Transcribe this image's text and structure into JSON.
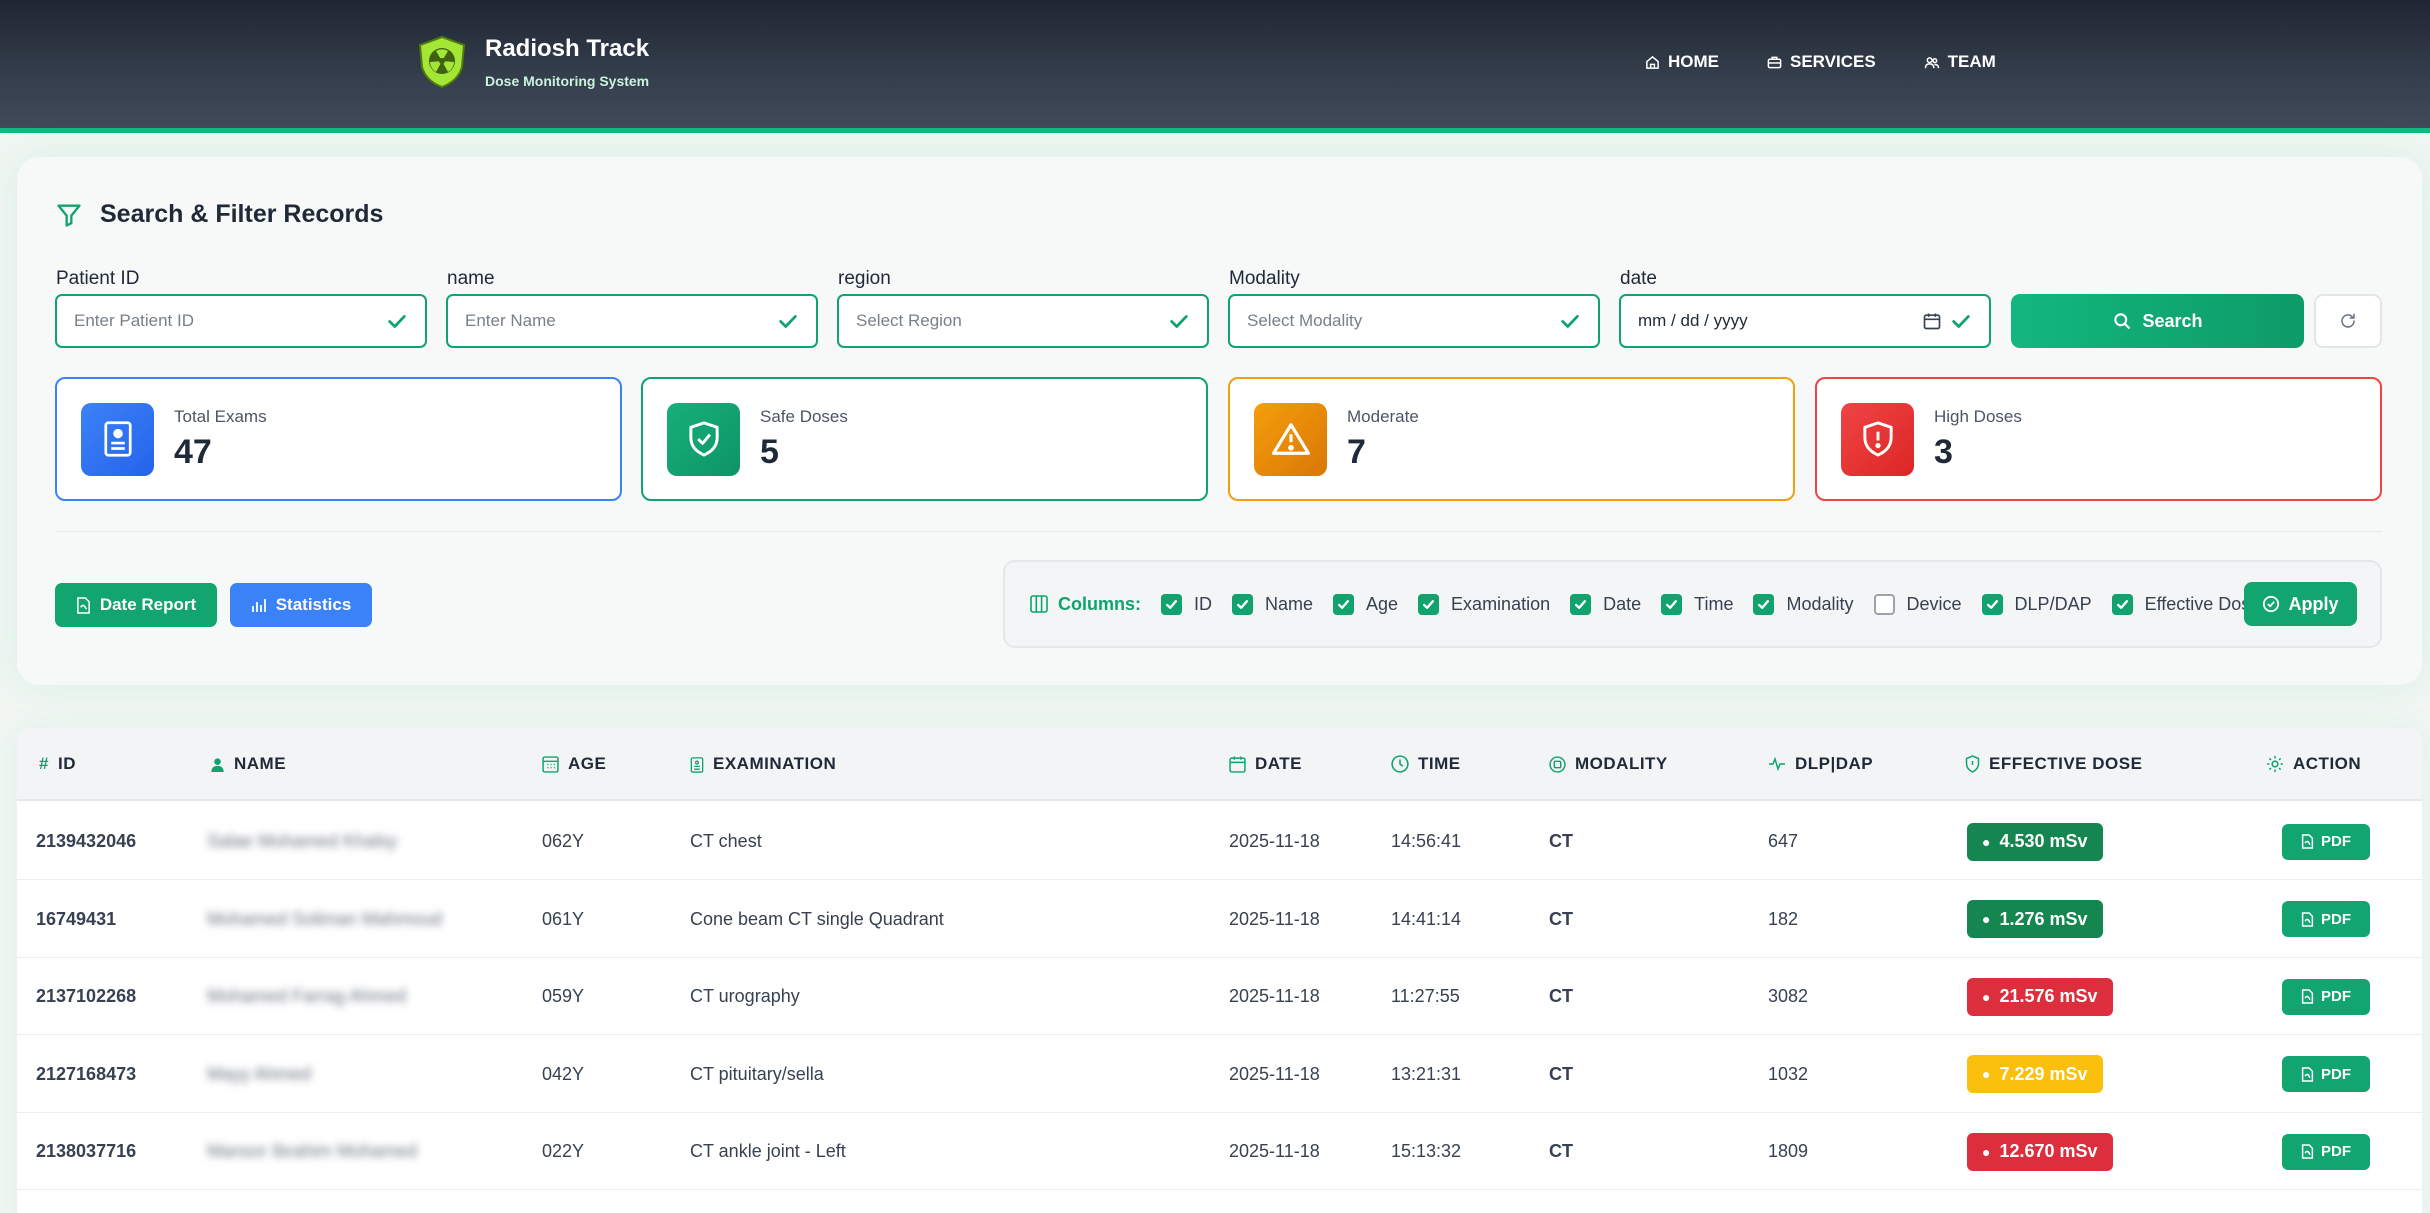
{
  "header": {
    "brand_title": "Radiosh Track",
    "brand_subtitle": "Dose Monitoring System",
    "nav": [
      {
        "label": "HOME",
        "icon": "home-icon"
      },
      {
        "label": "SERVICES",
        "icon": "briefcase-icon"
      },
      {
        "label": "TEAM",
        "icon": "users-icon"
      }
    ]
  },
  "filter": {
    "title": "Search & Filter Records",
    "fields": [
      {
        "label": "Patient ID",
        "placeholder": "Enter Patient ID"
      },
      {
        "label": "name",
        "placeholder": "Enter Name"
      },
      {
        "label": "region",
        "placeholder": "Select Region"
      },
      {
        "label": "Modality",
        "placeholder": "Select Modality"
      },
      {
        "label": "date",
        "value": "mm / dd / yyyy"
      }
    ],
    "search_label": "Search"
  },
  "stats": [
    {
      "label": "Total Exams",
      "value": "47",
      "color": "#3b82f6"
    },
    {
      "label": "Safe Doses",
      "value": "5",
      "color": "#10a36d"
    },
    {
      "label": "Moderate",
      "value": "7",
      "color": "#f59e0b"
    },
    {
      "label": "High Doses",
      "value": "3",
      "color": "#ef4444"
    }
  ],
  "actions": {
    "date_report": "Date Report",
    "statistics": "Statistics"
  },
  "columns": {
    "label": "Columns:",
    "options": [
      {
        "label": "ID",
        "checked": true
      },
      {
        "label": "Name",
        "checked": true
      },
      {
        "label": "Age",
        "checked": true
      },
      {
        "label": "Examination",
        "checked": true
      },
      {
        "label": "Date",
        "checked": true
      },
      {
        "label": "Time",
        "checked": true
      },
      {
        "label": "Modality",
        "checked": true
      },
      {
        "label": "Device",
        "checked": false
      },
      {
        "label": "DLP/DAP",
        "checked": true
      },
      {
        "label": "Effective Dose",
        "checked": true
      }
    ],
    "apply_label": "Apply"
  },
  "table": {
    "headers": {
      "id": "ID",
      "name": "NAME",
      "age": "AGE",
      "examination": "EXAMINATION",
      "date": "DATE",
      "time": "TIME",
      "modality": "MODALITY",
      "dlp": "DLP|DAP",
      "dose": "EFFECTIVE DOSE",
      "action": "ACTION"
    },
    "hash": "#",
    "pdf_label": "PDF",
    "rows": [
      {
        "id": "2139432046",
        "name": "Salae Mohamed Khalsy",
        "age": "062Y",
        "exam": "CT chest",
        "date": "2025-11-18",
        "time": "14:56:41",
        "modality": "CT",
        "dlp": "647",
        "dose": "4.530 mSv",
        "dose_color": "#15864f"
      },
      {
        "id": "16749431",
        "name": "Mohamed Soliman Mahmoud",
        "age": "061Y",
        "exam": "Cone beam CT single Quadrant",
        "date": "2025-11-18",
        "time": "14:41:14",
        "modality": "CT",
        "dlp": "182",
        "dose": "1.276 mSv",
        "dose_color": "#15864f"
      },
      {
        "id": "2137102268",
        "name": "Mohamed Farrag Ahmed",
        "age": "059Y",
        "exam": "CT urography",
        "date": "2025-11-18",
        "time": "11:27:55",
        "modality": "CT",
        "dlp": "3082",
        "dose": "21.576 mSv",
        "dose_color": "#dc2e3c"
      },
      {
        "id": "2127168473",
        "name": "Mayy Ahmed",
        "age": "042Y",
        "exam": "CT pituitary/sella",
        "date": "2025-11-18",
        "time": "13:21:31",
        "modality": "CT",
        "dlp": "1032",
        "dose": "7.229 mSv",
        "dose_color": "#fbbf0e"
      },
      {
        "id": "2138037716",
        "name": "Mansor Ibrahim Mohamed",
        "age": "022Y",
        "exam": "CT ankle joint - Left",
        "date": "2025-11-18",
        "time": "15:13:32",
        "modality": "CT",
        "dlp": "1809",
        "dose": "12.670 mSv",
        "dose_color": "#dc2e3c"
      }
    ]
  }
}
